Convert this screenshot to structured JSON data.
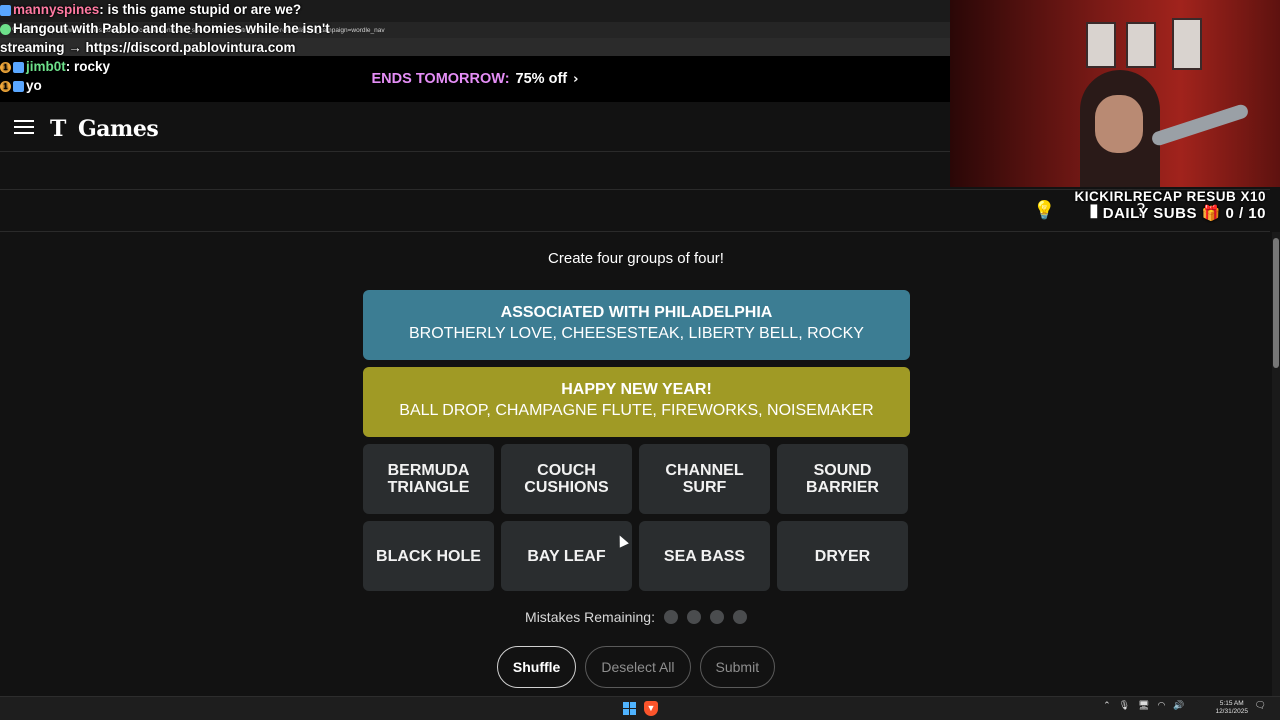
{
  "browser": {
    "url": "https://www.nytimes.com/games/connections?utm_source=wordle&utm_medium=referral&utm_campaign=wordle_nav",
    "nav_icons": [
      "reload-icon",
      "bookmark-icon"
    ]
  },
  "promo": {
    "ends": "ENDS TOMORROW:",
    "discount": "75% off",
    "chevron": "›"
  },
  "header": {
    "logo_mark": "T",
    "logo_text": "Games"
  },
  "chat": [
    {
      "user": "mannyspines",
      "message": ": is this game stupid or are we?"
    },
    {
      "user": "",
      "message": "Hangout with Pablo and the homies while he isn't streaming → https://discord.pablovintura.com"
    },
    {
      "user": "jimb0t",
      "message": ": rocky"
    },
    {
      "user": "",
      "message": "yo"
    }
  ],
  "overlay": {
    "resub_line1": "KICKIRLRECAP RESUB X10",
    "resub_line2": "DAILY SUBS 🎁 0 / 10"
  },
  "game": {
    "instructions": "Create four groups of four!",
    "solved": [
      {
        "title": "ASSOCIATED WITH PHILADELPHIA",
        "words": "BROTHERLY LOVE, CHEESESTEAK, LIBERTY BELL, ROCKY",
        "color": "#3c7d93"
      },
      {
        "title": "HAPPY NEW YEAR!",
        "words": "BALL DROP, CHAMPAGNE FLUTE, FIREWORKS, NOISEMAKER",
        "color": "#a09a25"
      }
    ],
    "tiles": [
      "BERMUDA TRIANGLE",
      "COUCH CUSHIONS",
      "CHANNEL SURF",
      "SOUND BARRIER",
      "BLACK HOLE",
      "BAY LEAF",
      "SEA BASS",
      "DRYER"
    ],
    "mistakes_label": "Mistakes Remaining:",
    "mistakes_remaining": 4,
    "buttons": {
      "shuffle": "Shuffle",
      "deselect": "Deselect All",
      "submit": "Submit"
    }
  },
  "taskbar": {
    "time": "5:15 AM",
    "date": "12/31/2025"
  }
}
